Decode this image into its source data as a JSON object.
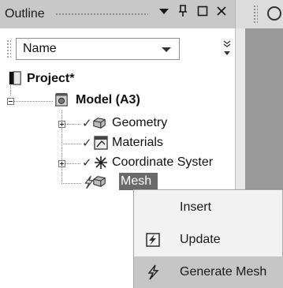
{
  "panel": {
    "title": "Outline",
    "pin_glyph": "⮟",
    "dock_glyph": "٢",
    "max_glyph": "□",
    "close_glyph": "✕"
  },
  "toolbar": {
    "filter_value": "Name",
    "overflow_glyph": "»"
  },
  "tree": {
    "project": "Project*",
    "model": "Model (A3)",
    "geometry": "Geometry",
    "materials": "Materials",
    "coordinate_systems": "Coordinate Syster",
    "mesh": "Mesh",
    "check_glyph": "✓"
  },
  "context_menu": {
    "insert": "Insert",
    "update": "Update",
    "generate_mesh": "Generate Mesh"
  },
  "colors": {
    "selected": "#6a6a6a",
    "menu_highlight": "#c6c6c6"
  }
}
